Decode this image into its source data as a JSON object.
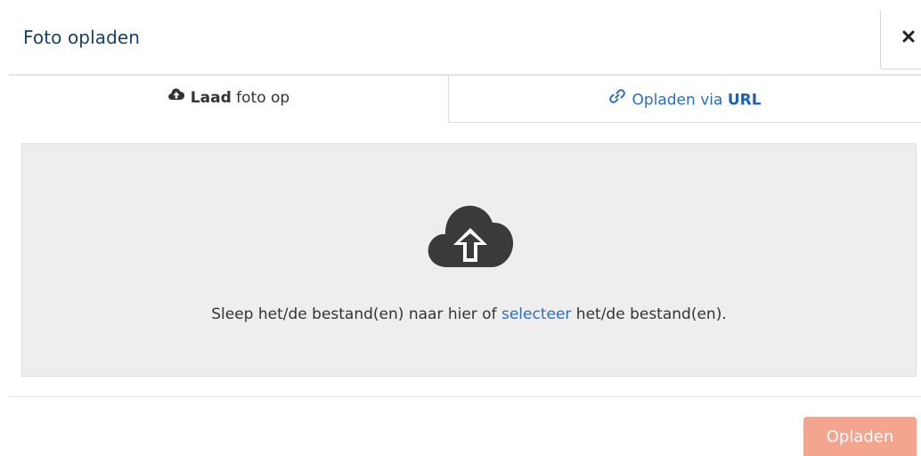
{
  "dialog": {
    "title": "Foto opladen",
    "close_icon": "close-icon"
  },
  "tabs": [
    {
      "icon": "cloud-upload-icon",
      "label_bold": "Laad",
      "label_rest": " foto op",
      "active": true
    },
    {
      "icon": "link-icon",
      "label_prefix": "Opladen via ",
      "label_bold": "URL",
      "active": false
    }
  ],
  "dropzone": {
    "icon": "cloud-upload-icon",
    "text_before": "Sleep het/de bestand(en) naar hier of ",
    "link_text": "selecteer",
    "text_after": " het/de bestand(en)."
  },
  "footer": {
    "upload_button": "Opladen"
  },
  "colors": {
    "title": "#1c3f66",
    "link": "#2a6fc0",
    "dropzone_bg": "#eeeeee",
    "upload_button_bg": "#f4a590",
    "icon_dark": "#3a3a3a"
  }
}
